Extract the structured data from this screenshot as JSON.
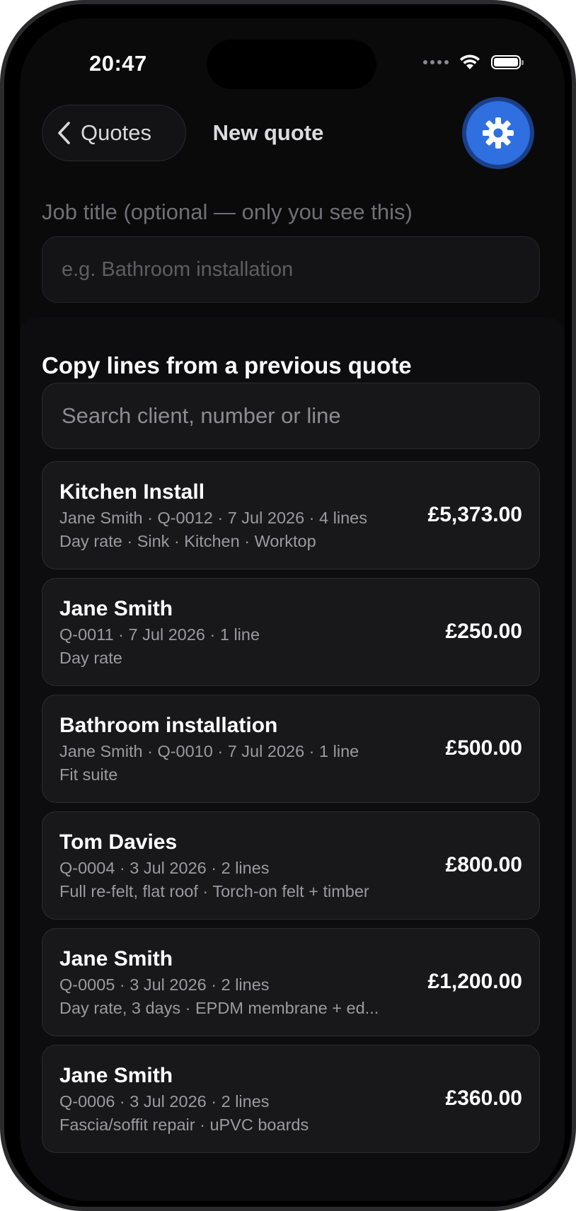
{
  "status": {
    "time": "20:47"
  },
  "nav": {
    "back_label": "Quotes",
    "title": "New quote"
  },
  "colors": {
    "accent": "#2f6fe0",
    "background": "#0a0a0b",
    "card": "#18181b"
  },
  "icons": {
    "back": "chevron-left-icon",
    "settings": "gear-icon"
  },
  "job_title": {
    "label": "Job title (optional — only you see this)",
    "placeholder": "e.g. Bathroom installation",
    "value": ""
  },
  "copy_section": {
    "title": "Copy lines from a previous quote",
    "search_placeholder": "Search client, number or line"
  },
  "quotes": [
    {
      "title": "Kitchen Install",
      "meta": "Jane Smith · Q-0012 · 7 Jul 2026 · 4 lines",
      "lines": "Day rate · Sink · Kitchen · Worktop",
      "total": "£5,373.00"
    },
    {
      "title": "Jane Smith",
      "meta": "Q-0011 · 7 Jul 2026 · 1 line",
      "lines": "Day rate",
      "total": "£250.00"
    },
    {
      "title": "Bathroom installation",
      "meta": "Jane Smith · Q-0010 · 7 Jul 2026 · 1 line",
      "lines": "Fit suite",
      "total": "£500.00"
    },
    {
      "title": "Tom Davies",
      "meta": "Q-0004 · 3 Jul 2026 · 2 lines",
      "lines": "Full re-felt, flat roof · Torch-on felt + timber",
      "total": "£800.00"
    },
    {
      "title": "Jane Smith",
      "meta": "Q-0005 · 3 Jul 2026 · 2 lines",
      "lines": "Day rate, 3 days · EPDM membrane + ed...",
      "total": "£1,200.00"
    },
    {
      "title": "Jane Smith",
      "meta": "Q-0006 · 3 Jul 2026 · 2 lines",
      "lines": "Fascia/soffit repair · uPVC boards",
      "total": "£360.00"
    }
  ]
}
